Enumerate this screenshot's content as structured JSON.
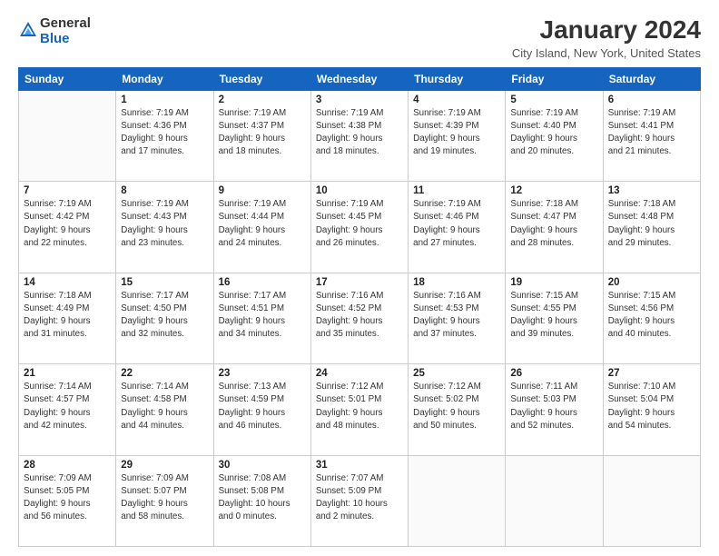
{
  "logo": {
    "general": "General",
    "blue": "Blue"
  },
  "header": {
    "title": "January 2024",
    "subtitle": "City Island, New York, United States"
  },
  "weekdays": [
    "Sunday",
    "Monday",
    "Tuesday",
    "Wednesday",
    "Thursday",
    "Friday",
    "Saturday"
  ],
  "weeks": [
    [
      {
        "day": "",
        "info": ""
      },
      {
        "day": "1",
        "info": "Sunrise: 7:19 AM\nSunset: 4:36 PM\nDaylight: 9 hours\nand 17 minutes."
      },
      {
        "day": "2",
        "info": "Sunrise: 7:19 AM\nSunset: 4:37 PM\nDaylight: 9 hours\nand 18 minutes."
      },
      {
        "day": "3",
        "info": "Sunrise: 7:19 AM\nSunset: 4:38 PM\nDaylight: 9 hours\nand 18 minutes."
      },
      {
        "day": "4",
        "info": "Sunrise: 7:19 AM\nSunset: 4:39 PM\nDaylight: 9 hours\nand 19 minutes."
      },
      {
        "day": "5",
        "info": "Sunrise: 7:19 AM\nSunset: 4:40 PM\nDaylight: 9 hours\nand 20 minutes."
      },
      {
        "day": "6",
        "info": "Sunrise: 7:19 AM\nSunset: 4:41 PM\nDaylight: 9 hours\nand 21 minutes."
      }
    ],
    [
      {
        "day": "7",
        "info": "Sunrise: 7:19 AM\nSunset: 4:42 PM\nDaylight: 9 hours\nand 22 minutes."
      },
      {
        "day": "8",
        "info": "Sunrise: 7:19 AM\nSunset: 4:43 PM\nDaylight: 9 hours\nand 23 minutes."
      },
      {
        "day": "9",
        "info": "Sunrise: 7:19 AM\nSunset: 4:44 PM\nDaylight: 9 hours\nand 24 minutes."
      },
      {
        "day": "10",
        "info": "Sunrise: 7:19 AM\nSunset: 4:45 PM\nDaylight: 9 hours\nand 26 minutes."
      },
      {
        "day": "11",
        "info": "Sunrise: 7:19 AM\nSunset: 4:46 PM\nDaylight: 9 hours\nand 27 minutes."
      },
      {
        "day": "12",
        "info": "Sunrise: 7:18 AM\nSunset: 4:47 PM\nDaylight: 9 hours\nand 28 minutes."
      },
      {
        "day": "13",
        "info": "Sunrise: 7:18 AM\nSunset: 4:48 PM\nDaylight: 9 hours\nand 29 minutes."
      }
    ],
    [
      {
        "day": "14",
        "info": "Sunrise: 7:18 AM\nSunset: 4:49 PM\nDaylight: 9 hours\nand 31 minutes."
      },
      {
        "day": "15",
        "info": "Sunrise: 7:17 AM\nSunset: 4:50 PM\nDaylight: 9 hours\nand 32 minutes."
      },
      {
        "day": "16",
        "info": "Sunrise: 7:17 AM\nSunset: 4:51 PM\nDaylight: 9 hours\nand 34 minutes."
      },
      {
        "day": "17",
        "info": "Sunrise: 7:16 AM\nSunset: 4:52 PM\nDaylight: 9 hours\nand 35 minutes."
      },
      {
        "day": "18",
        "info": "Sunrise: 7:16 AM\nSunset: 4:53 PM\nDaylight: 9 hours\nand 37 minutes."
      },
      {
        "day": "19",
        "info": "Sunrise: 7:15 AM\nSunset: 4:55 PM\nDaylight: 9 hours\nand 39 minutes."
      },
      {
        "day": "20",
        "info": "Sunrise: 7:15 AM\nSunset: 4:56 PM\nDaylight: 9 hours\nand 40 minutes."
      }
    ],
    [
      {
        "day": "21",
        "info": "Sunrise: 7:14 AM\nSunset: 4:57 PM\nDaylight: 9 hours\nand 42 minutes."
      },
      {
        "day": "22",
        "info": "Sunrise: 7:14 AM\nSunset: 4:58 PM\nDaylight: 9 hours\nand 44 minutes."
      },
      {
        "day": "23",
        "info": "Sunrise: 7:13 AM\nSunset: 4:59 PM\nDaylight: 9 hours\nand 46 minutes."
      },
      {
        "day": "24",
        "info": "Sunrise: 7:12 AM\nSunset: 5:01 PM\nDaylight: 9 hours\nand 48 minutes."
      },
      {
        "day": "25",
        "info": "Sunrise: 7:12 AM\nSunset: 5:02 PM\nDaylight: 9 hours\nand 50 minutes."
      },
      {
        "day": "26",
        "info": "Sunrise: 7:11 AM\nSunset: 5:03 PM\nDaylight: 9 hours\nand 52 minutes."
      },
      {
        "day": "27",
        "info": "Sunrise: 7:10 AM\nSunset: 5:04 PM\nDaylight: 9 hours\nand 54 minutes."
      }
    ],
    [
      {
        "day": "28",
        "info": "Sunrise: 7:09 AM\nSunset: 5:05 PM\nDaylight: 9 hours\nand 56 minutes."
      },
      {
        "day": "29",
        "info": "Sunrise: 7:09 AM\nSunset: 5:07 PM\nDaylight: 9 hours\nand 58 minutes."
      },
      {
        "day": "30",
        "info": "Sunrise: 7:08 AM\nSunset: 5:08 PM\nDaylight: 10 hours\nand 0 minutes."
      },
      {
        "day": "31",
        "info": "Sunrise: 7:07 AM\nSunset: 5:09 PM\nDaylight: 10 hours\nand 2 minutes."
      },
      {
        "day": "",
        "info": ""
      },
      {
        "day": "",
        "info": ""
      },
      {
        "day": "",
        "info": ""
      }
    ]
  ]
}
